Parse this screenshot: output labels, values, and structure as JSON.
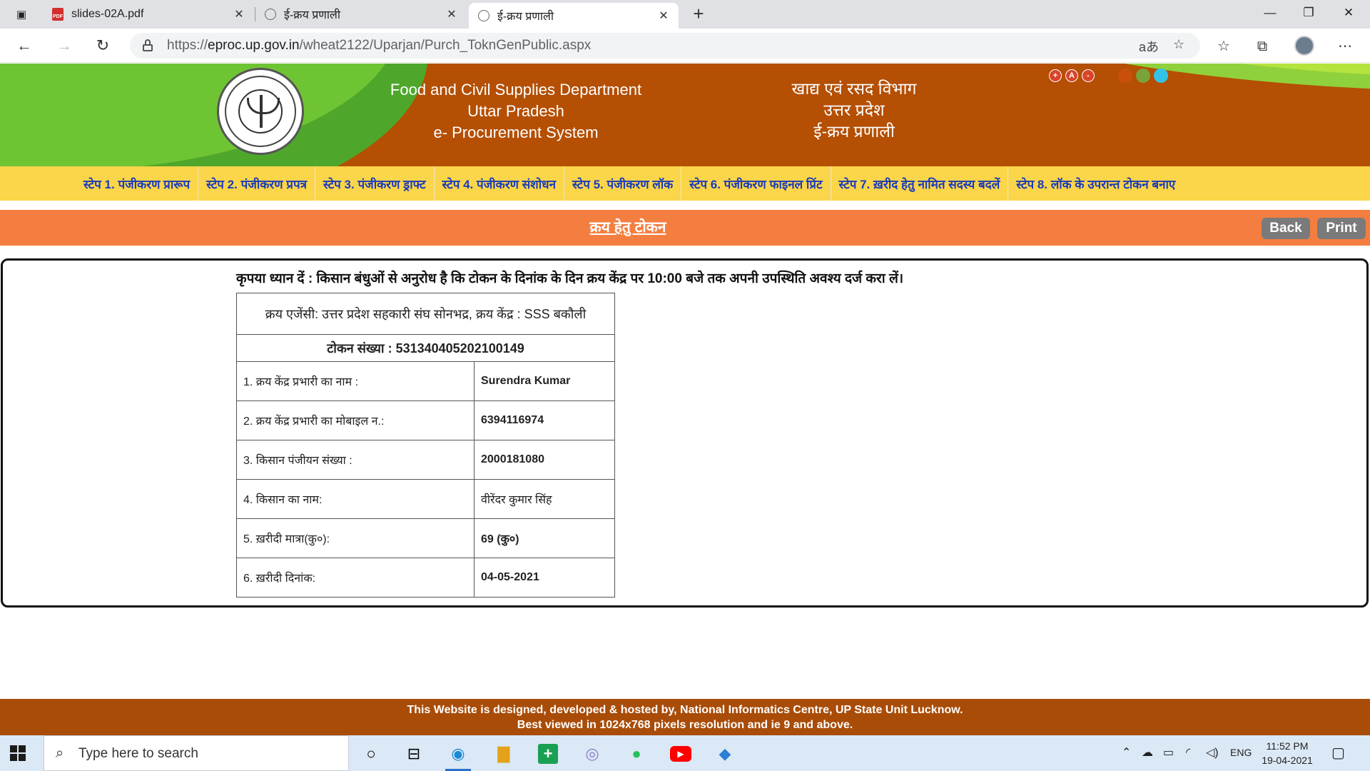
{
  "browser": {
    "tabs": [
      {
        "title": "slides-02A.pdf",
        "icon": "pdf-icon",
        "active": false
      },
      {
        "title": "ई-क्रय प्रणाली",
        "icon": "emblem-favicon",
        "active": false
      },
      {
        "title": "ई-क्रय प्रणाली",
        "icon": "emblem-favicon",
        "active": true
      }
    ],
    "url_scheme": "https://",
    "url_host": "eproc.up.gov.in",
    "url_path": "/wheat2122/Uparjan/Purch_ToknGenPublic.aspx",
    "read_aloud_glyph": "aあ"
  },
  "header": {
    "english_lines": [
      "Food and Civil Supplies Department",
      "Uttar Pradesh",
      "e- Procurement System"
    ],
    "hindi_lines": [
      "खाद्य एवं रसद विभाग",
      "उत्तर प्रदेश",
      "ई-क्रय प्रणाली"
    ],
    "font_size_buttons": [
      "+",
      "A",
      "-"
    ],
    "theme_colors": [
      "#c9500a",
      "#7aa33a",
      "#33c3e8"
    ]
  },
  "steps": [
    "स्टेप 1. पंजीकरण प्रारूप",
    "स्टेप 2. पंजीकरण प्रपत्र",
    "स्टेप 3. पंजीकरण ड्राफ्ट",
    "स्टेप 4. पंजीकरण संशोधन",
    "स्टेप 5. पंजीकरण लॉक",
    "स्टेप 6. पंजीकरण फाइनल प्रिंट",
    "स्टेप 7. ख़रीद हेतु नामित सदस्य बदलें",
    "स्टेप 8. लॉक के उपरान्त टोकन बनाए"
  ],
  "page": {
    "title": "क्रय हेतु टोकन",
    "back_label": "Back",
    "print_label": "Print"
  },
  "notice": "कृपया ध्यान दें : किसान बंधुओं से अनुरोध है कि टोकन के दिनांक के दिन क्रय केंद्र पर 10:00 बजे तक अपनी उपस्थिति अवश्य दर्ज करा लें।",
  "token": {
    "agency_line": "क्रय एजेंसी: उत्तर प्रदेश सहकारी संघ सोनभद्र, क्रय केंद्र : SSS बकौली",
    "token_line": "टोकन संख्या : 531340405202100149",
    "rows": [
      {
        "label": "1. क्रय केंद्र प्रभारी का नाम :",
        "value": "Surendra Kumar"
      },
      {
        "label": "2. क्रय केंद्र प्रभारी का मोबाइल न.:",
        "value": "6394116974"
      },
      {
        "label": "3. किसान पंजीयन संख्या :",
        "value": "2000181080"
      },
      {
        "label": "4. किसान का नाम:",
        "value": "वीरेंदर कुमार सिंह"
      },
      {
        "label": "5. ख़रीदी मात्रा(कु०):",
        "value": "69 (कु०)"
      },
      {
        "label": "6. ख़रीदी दिनांक:",
        "value": "04-05-2021"
      }
    ]
  },
  "footer": {
    "line1": "This Website is designed, developed & hosted by, National Informatics Centre, UP State Unit Lucknow.",
    "line2": "Best viewed in 1024x768 pixels resolution and ie 9 and above."
  },
  "taskbar": {
    "search_placeholder": "Type here to search",
    "language": "ENG",
    "time": "11:52 PM",
    "date": "19-04-2021",
    "apps": [
      "cortana-icon",
      "task-view-icon",
      "edge-icon",
      "file-explorer-icon",
      "sheets-icon",
      "app-icon",
      "whatsapp-icon",
      "youtube-icon",
      "vscode-icon"
    ]
  }
}
